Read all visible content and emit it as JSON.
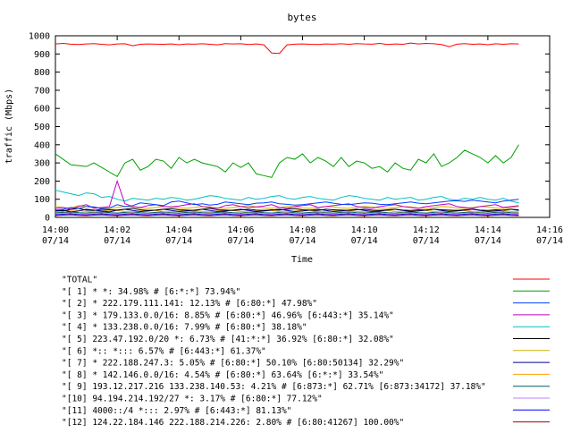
{
  "chart_data": {
    "type": "line",
    "title": "bytes",
    "xlabel": "Time",
    "ylabel": "traffic (Mbps)",
    "ylim": [
      0,
      1000
    ],
    "yticks": [
      0,
      100,
      200,
      300,
      400,
      500,
      600,
      700,
      800,
      900,
      1000
    ],
    "xlim": [
      "14:00",
      "14:16"
    ],
    "xticks": [
      {
        "time": "14:00",
        "date": "07/14"
      },
      {
        "time": "14:02",
        "date": "07/14"
      },
      {
        "time": "14:04",
        "date": "07/14"
      },
      {
        "time": "14:06",
        "date": "07/14"
      },
      {
        "time": "14:08",
        "date": "07/14"
      },
      {
        "time": "14:10",
        "date": "07/14"
      },
      {
        "time": "14:12",
        "date": "07/14"
      },
      {
        "time": "14:14",
        "date": "07/14"
      },
      {
        "time": "14:16",
        "date": "07/14"
      }
    ],
    "grid": false,
    "legend_position": "bottom",
    "x": [
      "14:00:00",
      "14:00:15",
      "14:00:30",
      "14:00:45",
      "14:01:00",
      "14:01:15",
      "14:01:30",
      "14:01:45",
      "14:02:00",
      "14:02:15",
      "14:02:30",
      "14:02:45",
      "14:03:00",
      "14:03:15",
      "14:03:30",
      "14:03:45",
      "14:04:00",
      "14:04:15",
      "14:04:30",
      "14:04:45",
      "14:05:00",
      "14:05:15",
      "14:05:30",
      "14:05:45",
      "14:06:00",
      "14:06:15",
      "14:06:30",
      "14:06:45",
      "14:07:00",
      "14:07:15",
      "14:07:30",
      "14:07:45",
      "14:08:00",
      "14:08:15",
      "14:08:30",
      "14:08:45",
      "14:09:00",
      "14:09:15",
      "14:09:30",
      "14:09:45",
      "14:10:00",
      "14:10:15",
      "14:10:30",
      "14:10:45",
      "14:11:00",
      "14:11:15",
      "14:11:30",
      "14:11:45",
      "14:12:00",
      "14:12:15",
      "14:12:30",
      "14:12:45",
      "14:13:00",
      "14:13:15",
      "14:13:30",
      "14:13:45",
      "14:14:00",
      "14:14:15",
      "14:14:30",
      "14:14:45",
      "14:15:00"
    ],
    "series": [
      {
        "name": "\"TOTAL\"",
        "color": "#ff0000",
        "values": [
          955,
          958,
          954,
          952,
          955,
          957,
          953,
          950,
          955,
          956,
          945,
          953,
          955,
          954,
          953,
          955,
          951,
          955,
          954,
          956,
          953,
          950,
          957,
          955,
          956,
          952,
          955,
          950,
          905,
          903,
          950,
          954,
          955,
          953,
          952,
          955,
          954,
          956,
          953,
          957,
          955,
          954,
          958,
          952,
          955,
          953,
          960,
          955,
          958,
          956,
          952,
          940,
          954,
          957,
          953,
          955,
          951,
          956,
          953,
          956,
          955
        ]
      },
      {
        "name": "\"[ 1] * *: 34.98% # [6:*:*] 73.94%\"",
        "color": "#00a000",
        "values": [
          350,
          320,
          290,
          285,
          280,
          300,
          275,
          250,
          225,
          300,
          320,
          260,
          280,
          320,
          310,
          270,
          330,
          300,
          320,
          300,
          290,
          280,
          250,
          300,
          275,
          300,
          240,
          230,
          220,
          300,
          330,
          320,
          350,
          300,
          330,
          310,
          280,
          330,
          280,
          310,
          300,
          270,
          280,
          250,
          300,
          270,
          260,
          320,
          300,
          350,
          280,
          300,
          330,
          370,
          350,
          330,
          300,
          340,
          300,
          330,
          400
        ]
      },
      {
        "name": "\"[ 2] * 222.179.111.141: 12.13% # [6:80:*] 47.98%\"",
        "color": "#0040ff",
        "values": [
          40,
          45,
          55,
          50,
          60,
          58,
          48,
          52,
          70,
          60,
          65,
          80,
          75,
          70,
          65,
          85,
          90,
          80,
          70,
          75,
          68,
          72,
          85,
          80,
          75,
          70,
          78,
          80,
          85,
          75,
          72,
          68,
          70,
          75,
          80,
          85,
          78,
          72,
          70,
          75,
          80,
          78,
          72,
          70,
          75,
          80,
          85,
          78,
          75,
          80,
          85,
          90,
          92,
          88,
          95,
          90,
          85,
          80,
          90,
          95,
          100
        ]
      },
      {
        "name": "\"[ 3] * 179.133.0.0/16: 8.85% # [6:80:*] 46.96% [6:443:*] 35.14%\"",
        "color": "#c000c0",
        "values": [
          50,
          55,
          45,
          60,
          70,
          50,
          55,
          60,
          200,
          75,
          60,
          55,
          65,
          70,
          60,
          58,
          62,
          70,
          75,
          60,
          55,
          50,
          65,
          70,
          60,
          55,
          58,
          62,
          70,
          55,
          50,
          60,
          65,
          70,
          55,
          60,
          65,
          70,
          75,
          60,
          55,
          50,
          60,
          65,
          70,
          60,
          55,
          50,
          60,
          65,
          70,
          75,
          60,
          55,
          50,
          60,
          65,
          70,
          55,
          60,
          65
        ]
      },
      {
        "name": "\"[ 4] * 133.238.0.0/16: 7.99% # [6:80:*] 38.18%\"",
        "color": "#00c0c0",
        "values": [
          150,
          140,
          130,
          120,
          135,
          130,
          110,
          115,
          100,
          90,
          105,
          100,
          95,
          105,
          100,
          110,
          105,
          95,
          100,
          110,
          120,
          115,
          105,
          100,
          95,
          110,
          100,
          105,
          115,
          120,
          105,
          100,
          110,
          115,
          105,
          100,
          95,
          110,
          120,
          115,
          105,
          100,
          95,
          110,
          100,
          105,
          110,
          95,
          100,
          110,
          115,
          100,
          95,
          105,
          100,
          110,
          100,
          95,
          105,
          90,
          80
        ]
      },
      {
        "name": "\"[ 5] 223.47.192.0/20 *: 6.73% # [41:*:*] 36.92% [6:80:*] 32.08%\"",
        "color": "#000000",
        "values": [
          40,
          35,
          45,
          50,
          40,
          38,
          45,
          42,
          40,
          45,
          50,
          42,
          38,
          40,
          45,
          48,
          42,
          40,
          38,
          45,
          50,
          42,
          40,
          38,
          42,
          45,
          40,
          38,
          42,
          40,
          45,
          48,
          42,
          40,
          38,
          45,
          42,
          40,
          38,
          42,
          45,
          40,
          38,
          42,
          45,
          40,
          38,
          42,
          40,
          45,
          42,
          40,
          38,
          42,
          45,
          40,
          38,
          42,
          40,
          45,
          42
        ]
      },
      {
        "name": "\"[ 6] *:: *::: 6.57% # [6:443:*] 61.37%\"",
        "color": "#d0b000",
        "values": [
          60,
          55,
          50,
          65,
          60,
          55,
          50,
          48,
          55,
          60,
          58,
          52,
          50,
          55,
          60,
          58,
          52,
          50,
          55,
          60,
          58,
          52,
          50,
          55,
          60,
          65,
          58,
          52,
          50,
          55,
          60,
          58,
          52,
          50,
          55,
          60,
          58,
          52,
          50,
          55,
          60,
          58,
          52,
          50,
          55,
          60,
          58,
          52,
          50,
          55,
          60,
          58,
          52,
          50,
          55,
          60,
          58,
          52,
          50,
          55,
          60
        ]
      },
      {
        "name": "\"[ 7] * 222.188.247.3: 5.05% # [6:80:*] 50.10% [6:80:50134] 32.29%\"",
        "color": "#0000a0",
        "values": [
          35,
          40,
          30,
          35,
          45,
          40,
          35,
          30,
          40,
          45,
          38,
          32,
          35,
          40,
          45,
          38,
          32,
          35,
          40,
          45,
          38,
          32,
          35,
          40,
          45,
          38,
          32,
          35,
          40,
          45,
          38,
          32,
          35,
          40,
          45,
          38,
          32,
          35,
          40,
          45,
          38,
          32,
          35,
          40,
          45,
          38,
          32,
          35,
          40,
          45,
          38,
          32,
          35,
          40,
          45,
          38,
          32,
          35,
          40,
          45,
          38
        ]
      },
      {
        "name": "\"[ 8] * 142.146.0.0/16: 4.54% # [6:80:*] 63.64% [6:*:*] 33.54%\"",
        "color": "#ffa000",
        "values": [
          30,
          35,
          40,
          38,
          32,
          30,
          35,
          40,
          38,
          32,
          30,
          35,
          40,
          38,
          32,
          30,
          35,
          40,
          38,
          32,
          30,
          35,
          40,
          38,
          32,
          30,
          35,
          40,
          38,
          32,
          30,
          35,
          40,
          38,
          32,
          30,
          35,
          40,
          38,
          32,
          30,
          35,
          40,
          38,
          32,
          30,
          35,
          40,
          38,
          32,
          30,
          35,
          40,
          38,
          32,
          30,
          35,
          40,
          38,
          32,
          30
        ]
      },
      {
        "name": "\"[ 9] 193.12.217.216 133.238.140.53: 4.21% # [6:873:*] 62.71% [6:873:34172] 37.18%\"",
        "color": "#006060",
        "values": [
          25,
          28,
          30,
          26,
          24,
          28,
          30,
          26,
          24,
          28,
          30,
          26,
          24,
          28,
          30,
          26,
          24,
          28,
          30,
          26,
          24,
          28,
          30,
          26,
          24,
          28,
          30,
          26,
          24,
          28,
          30,
          26,
          24,
          28,
          30,
          26,
          24,
          28,
          30,
          26,
          24,
          28,
          30,
          26,
          24,
          28,
          30,
          26,
          24,
          28,
          30,
          26,
          24,
          28,
          30,
          26,
          24,
          28,
          30,
          26,
          24
        ]
      },
      {
        "name": "\"[10] 94.194.214.192/27 *: 3.17% # [6:80:*] 77.12%\"",
        "color": "#c080ff",
        "values": [
          20,
          22,
          25,
          20,
          18,
          22,
          25,
          20,
          18,
          22,
          25,
          20,
          18,
          22,
          25,
          20,
          18,
          22,
          25,
          20,
          18,
          22,
          25,
          20,
          18,
          22,
          25,
          20,
          18,
          22,
          25,
          20,
          18,
          22,
          25,
          20,
          18,
          22,
          25,
          20,
          18,
          22,
          25,
          20,
          18,
          22,
          25,
          20,
          18,
          22,
          25,
          20,
          18,
          22,
          25,
          20,
          18,
          22,
          25,
          20,
          18
        ]
      },
      {
        "name": "\"[11] 4000::/4 *::: 2.97% # [6:443:*] 81.13%\"",
        "color": "#0000ff",
        "values": [
          15,
          18,
          20,
          16,
          14,
          18,
          20,
          16,
          14,
          18,
          20,
          16,
          14,
          18,
          20,
          16,
          14,
          18,
          20,
          16,
          14,
          18,
          20,
          16,
          14,
          18,
          20,
          16,
          14,
          18,
          20,
          16,
          14,
          18,
          20,
          16,
          14,
          18,
          20,
          16,
          14,
          18,
          20,
          16,
          14,
          18,
          20,
          16,
          14,
          18,
          20,
          16,
          14,
          18,
          20,
          16,
          14,
          18,
          20,
          16,
          14
        ]
      },
      {
        "name": "\"[12] 124.22.184.146 222.188.214.226: 2.80% # [6:80:41267] 100.00%\"",
        "color": "#a00000",
        "values": [
          10,
          12,
          14,
          11,
          10,
          12,
          14,
          11,
          10,
          12,
          14,
          11,
          10,
          12,
          14,
          11,
          10,
          12,
          14,
          11,
          10,
          12,
          14,
          11,
          10,
          12,
          14,
          11,
          10,
          12,
          14,
          11,
          10,
          12,
          14,
          11,
          10,
          12,
          14,
          11,
          10,
          12,
          14,
          11,
          10,
          12,
          14,
          11,
          10,
          12,
          14,
          11,
          10,
          12,
          14,
          11,
          10,
          12,
          14,
          11,
          10
        ]
      }
    ]
  }
}
